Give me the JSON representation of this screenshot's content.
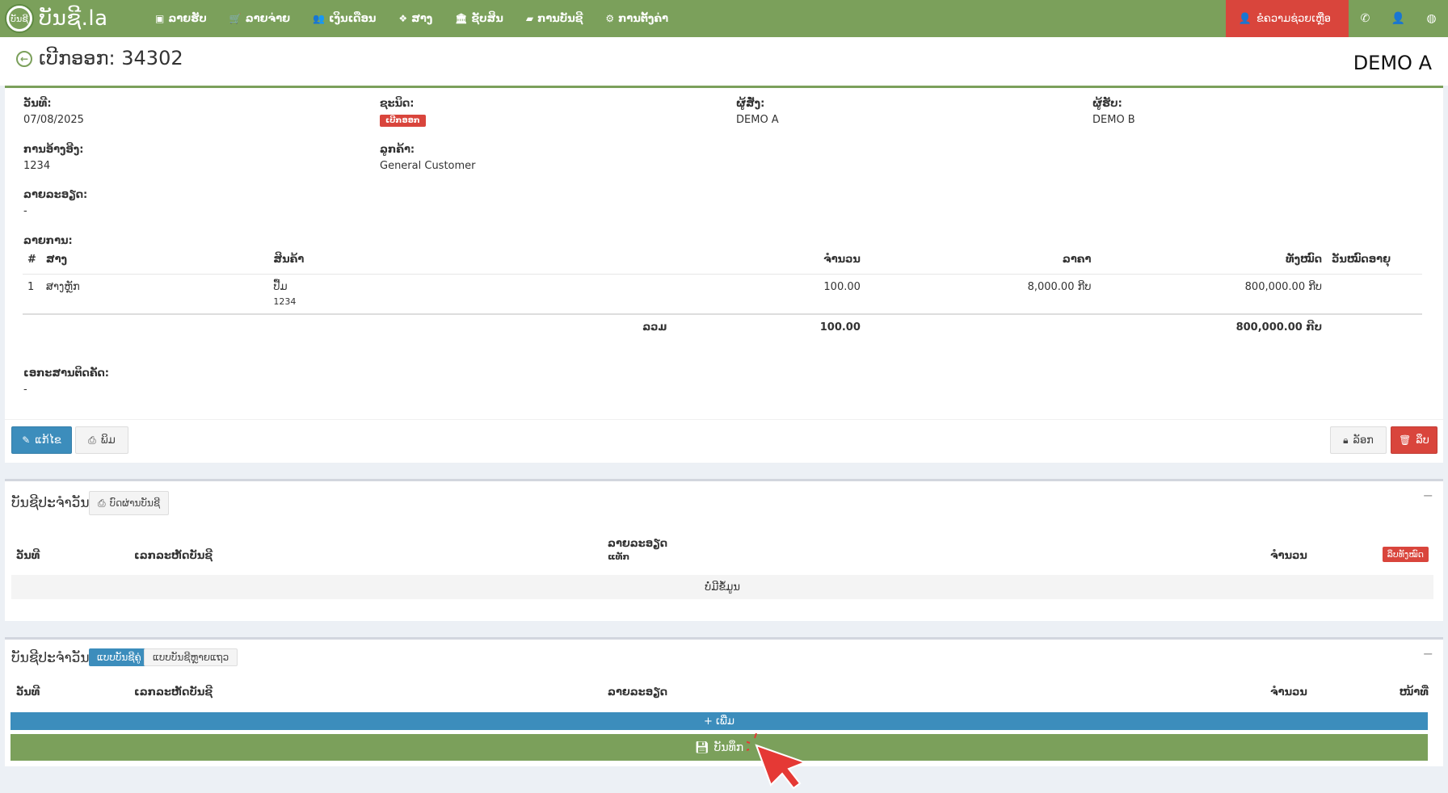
{
  "navbar": {
    "brand": "ບັນຊີ.la",
    "logo_text": "ບັນຊີ",
    "items": [
      {
        "icon": "money-icon",
        "glyph": "▣",
        "label": "ລາຍຮັບ"
      },
      {
        "icon": "cart-icon",
        "glyph": "🛒",
        "label": "ລາຍຈ່າຍ"
      },
      {
        "icon": "users-icon",
        "glyph": "👥",
        "label": "ເງິນເດືອນ"
      },
      {
        "icon": "dropbox-icon",
        "glyph": "❖",
        "label": "ສາງ"
      },
      {
        "icon": "bank-icon",
        "glyph": "🏛",
        "label": "ຊັບສິນ"
      },
      {
        "icon": "book-icon",
        "glyph": "▰",
        "label": "ການບັນຊີ"
      },
      {
        "icon": "gears-icon",
        "glyph": "⚙",
        "label": "ການຕັ້ງຄ່າ"
      }
    ],
    "help_label": "ຂໍຄວາມຊ່ວຍເຫຼືອ",
    "help_glyph": "👤",
    "right_icons": [
      {
        "icon": "whatsapp-icon",
        "glyph": "✆"
      },
      {
        "icon": "user-icon",
        "glyph": "👤"
      },
      {
        "icon": "globe-icon",
        "glyph": "◍"
      }
    ]
  },
  "header": {
    "back_glyph": "←",
    "title": "ເບີກອອກ: 34302",
    "company": "DEMO A"
  },
  "details": {
    "date_label": "ວັນທີ:",
    "date_value": "07/08/2025",
    "type_label": "ຊະນິດ:",
    "type_badge": "ເບີກອອກ",
    "buyer_label": "ຜູ້ສັ່ງ:",
    "buyer_value": "DEMO A",
    "receiver_label": "ຜູ້ຮັບ:",
    "receiver_value": "DEMO B",
    "reference_label": "ການອ້າງອີງ:",
    "reference_value": "1234",
    "customer_label": "ລູກຄ້າ:",
    "customer_value": "General Customer",
    "description_label": "ລາຍລະອຽດ:",
    "description_value": "-",
    "items_label": "ລາຍການ:",
    "attachments_label": "ເອກະສານຕິດຄັດ:",
    "attachments_value": "-"
  },
  "items_table": {
    "headers": {
      "num": "#",
      "warehouse": "ສາງ",
      "product": "ສິນຄ້າ",
      "qty": "ຈຳນວນ",
      "price": "ລາຄາ",
      "total": "ທັງໝົດ",
      "expiry": "ວັນໝົດອາຍຸ"
    },
    "rows": [
      {
        "num": "1",
        "warehouse": "ສາງຫຼັກ",
        "product": "ປື້ມ",
        "product_code": "1234",
        "qty": "100.00",
        "price": "8,000.00 ກີບ",
        "total": "800,000.00 ກີບ",
        "expiry": ""
      }
    ],
    "footer": {
      "label": "ລວມ",
      "qty": "100.00",
      "total": "800,000.00 ກີບ"
    }
  },
  "actions": {
    "edit_label": "ແກ້ໄຂ",
    "print_label": "ພິມ",
    "lock_label": "ລັອກ",
    "delete_label": "ລຶບ"
  },
  "journal_box": {
    "title": "ບັນຊີປະຈຳວັນ",
    "print_btn": "ບົດຜ່ານບັນຊີ",
    "col_date": "ວັນທີ",
    "col_number": "ເລກລະຫັດບັນຊີ",
    "col_desc": "ລາຍລະອຽດ",
    "col_desc_sub": "ແທັກ",
    "col_amount": "ຈຳນວນ",
    "delete_all": "ລຶບທັງໝົດ",
    "empty": "ບໍ່ມີຂໍ້ມູນ"
  },
  "journal_entry_box": {
    "title": "ບັນຊີປະຈຳວັນ",
    "mode_pair": "ແບບບັນຊີຄູ່",
    "mode_multi": "ແບບບັນຊີຫຼາຍແຖວ",
    "col_date": "ວັນທີ",
    "col_number": "ເລກລະຫັດບັນຊີ",
    "col_desc": "ລາຍລະອຽດ",
    "col_amount": "ຈຳນວນ",
    "col_side": "ໜ້າທີ່",
    "add_label": "+ ເພີ່ມ",
    "save_label": "ບັນທຶກ"
  },
  "colors": {
    "navbar": "#7ba05b",
    "danger": "#d9453c",
    "primary": "#3c8dbc"
  }
}
